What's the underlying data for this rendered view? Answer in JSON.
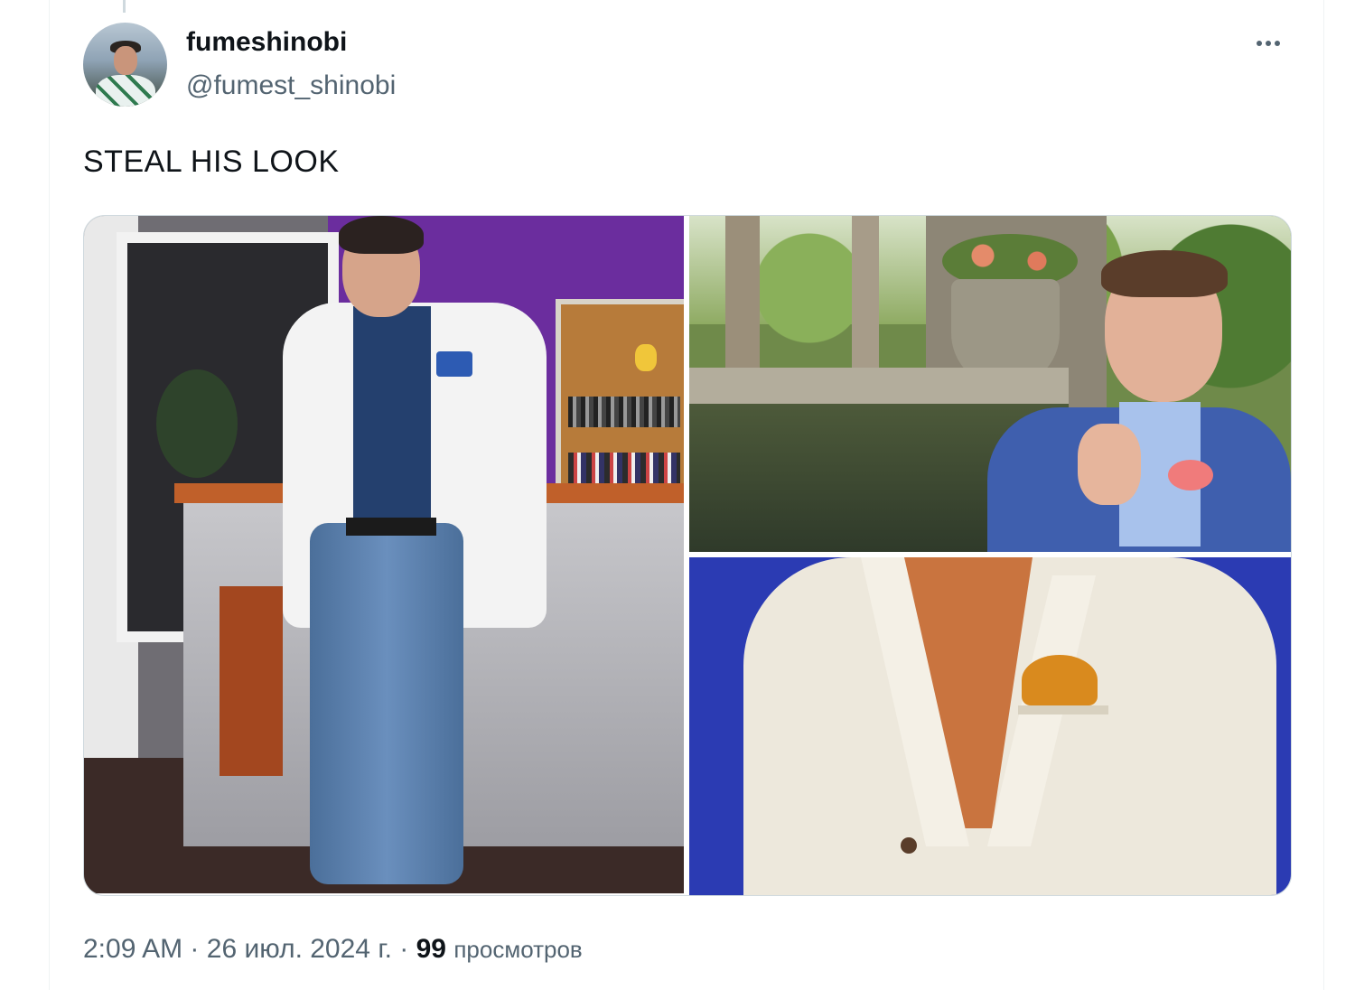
{
  "tweet": {
    "author": {
      "display_name": "fumeshinobi",
      "handle": "@fumest_shinobi"
    },
    "text": "STEAL HIS LOOK",
    "meta": {
      "time": "2:09 AM",
      "separator": "·",
      "date": "26 июл. 2024 г.",
      "views_count": "99",
      "views_label": "просмотров"
    },
    "more_icon": "more-horizontal-icon"
  },
  "colors": {
    "text_primary": "#0f1419",
    "text_secondary": "#536471",
    "border": "#cfd9de"
  }
}
